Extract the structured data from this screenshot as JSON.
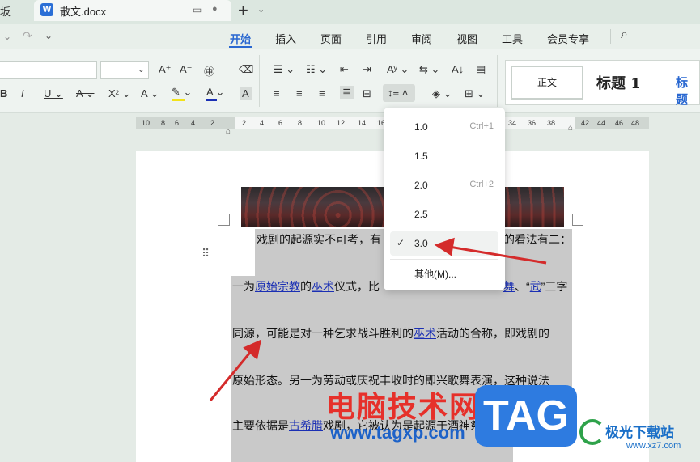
{
  "tabs": {
    "prev_label": "坂",
    "active_title": "散文.docx",
    "doc_icon_letter": "W",
    "new_tab": "+",
    "new_tab_chevron": "⌄"
  },
  "menu": {
    "items": [
      "开始",
      "插入",
      "页面",
      "引用",
      "审阅",
      "视图",
      "工具",
      "会员专享"
    ],
    "active_index": 0,
    "accent": "#2a68d1"
  },
  "ribbon": {
    "font_size_arrow": "⌄",
    "styles": {
      "normal": "正文",
      "heading1": "标题 1",
      "heading2": "标题"
    }
  },
  "ruler": {
    "ticks_left": [
      "10",
      "8",
      "6",
      "4",
      "2"
    ],
    "ticks_mid": [
      "2",
      "4",
      "6",
      "8",
      "10",
      "12",
      "14",
      "16"
    ],
    "ticks_right": [
      "34",
      "36",
      "38",
      "42",
      "44",
      "46",
      "48"
    ]
  },
  "document": {
    "line1": "戏剧的起源实不可考，有",
    "line1_tail": "的看法有二：",
    "line2_pre": "一为",
    "line2_link1": "原始宗教",
    "line2_mid": "的",
    "line2_link2": "巫术",
    "line2_post": "仪式，比",
    "line2_tail_link": "舞",
    "line2_tail": "、“",
    "line2_tail_link2": "武",
    "line2_tail2": "”三字",
    "line3_pre": "同源，可能是对一种乞求战斗胜利的",
    "line3_link": "巫术",
    "line3_post": "活动的合称，即戏剧的",
    "line4": "原始形态。另一为劳动或庆祝丰收时的即兴歌舞表演，这种说法",
    "line5_pre": "主要依据是",
    "line5_link": "古希腊",
    "line5_post": "戏剧，它被认为是起源于酒神祭祀"
  },
  "line_spacing_menu": {
    "items": [
      {
        "value": "1.0",
        "shortcut": "Ctrl+1"
      },
      {
        "value": "1.5",
        "shortcut": ""
      },
      {
        "value": "2.0",
        "shortcut": "Ctrl+2"
      },
      {
        "value": "2.5",
        "shortcut": ""
      },
      {
        "value": "3.0",
        "shortcut": "",
        "checked": true
      }
    ],
    "other": "其他(M)...",
    "check_mark": "✓"
  },
  "watermark": {
    "site_cn": "电脑技术网",
    "site_url": "www.tagxp.com",
    "tag": "TAG",
    "logo_cn": "极光下载站",
    "logo_url": "www.xz7.com"
  },
  "colors": {
    "arrow": "#d42b2b",
    "link": "#1a2fb4",
    "selection": "#c9c9c9"
  }
}
